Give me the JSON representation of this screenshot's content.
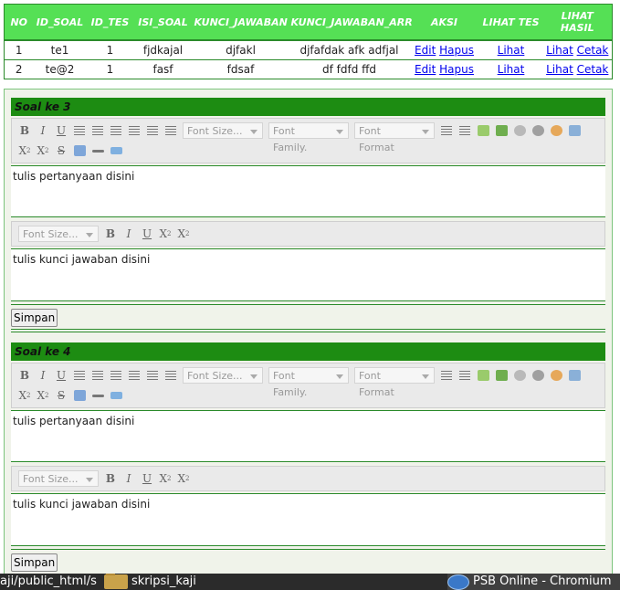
{
  "table": {
    "headers": [
      "NO",
      "ID_SOAL",
      "ID_TES",
      "ISI_SOAL",
      "KUNCI_JAWABAN",
      "KUNCI_JAWABAN_ARR",
      "AKSI",
      "LIHAT TES",
      "LIHAT HASIL"
    ],
    "rows": [
      {
        "no": "1",
        "id_soal": "te1",
        "id_tes": "1",
        "isi_soal": "fjdkajal",
        "kunci": "djfakl",
        "kunci_arr": "djfafdak afk adfjal",
        "edit": "Edit",
        "hapus": "Hapus",
        "lihat_tes": "Lihat",
        "lihat": "Lihat",
        "cetak": "Cetak"
      },
      {
        "no": "2",
        "id_soal": "te@2",
        "id_tes": "1",
        "isi_soal": "fasf",
        "kunci": "fdsaf",
        "kunci_arr": "df fdfd ffd",
        "edit": "Edit",
        "hapus": "Hapus",
        "lihat_tes": "Lihat",
        "lihat": "Lihat",
        "cetak": "Cetak"
      }
    ]
  },
  "toolbar": {
    "font_size": "Font Size...",
    "font_family": "Font Family.",
    "font_format": "Font Format"
  },
  "questions": [
    {
      "title": "Soal ke 3",
      "question_text": "tulis pertanyaan disini",
      "answer_text": "tulis kunci jawaban disini",
      "save_label": "Simpan"
    },
    {
      "title": "Soal ke 4",
      "question_text": "tulis pertanyaan disini",
      "answer_text": "tulis kunci jawaban disini",
      "save_label": "Simpan"
    }
  ],
  "taskbar": {
    "path_label": "aji/public_html/s",
    "folder_label": "skripsi_kaji",
    "browser_label": "PSB Online - Chromium"
  }
}
